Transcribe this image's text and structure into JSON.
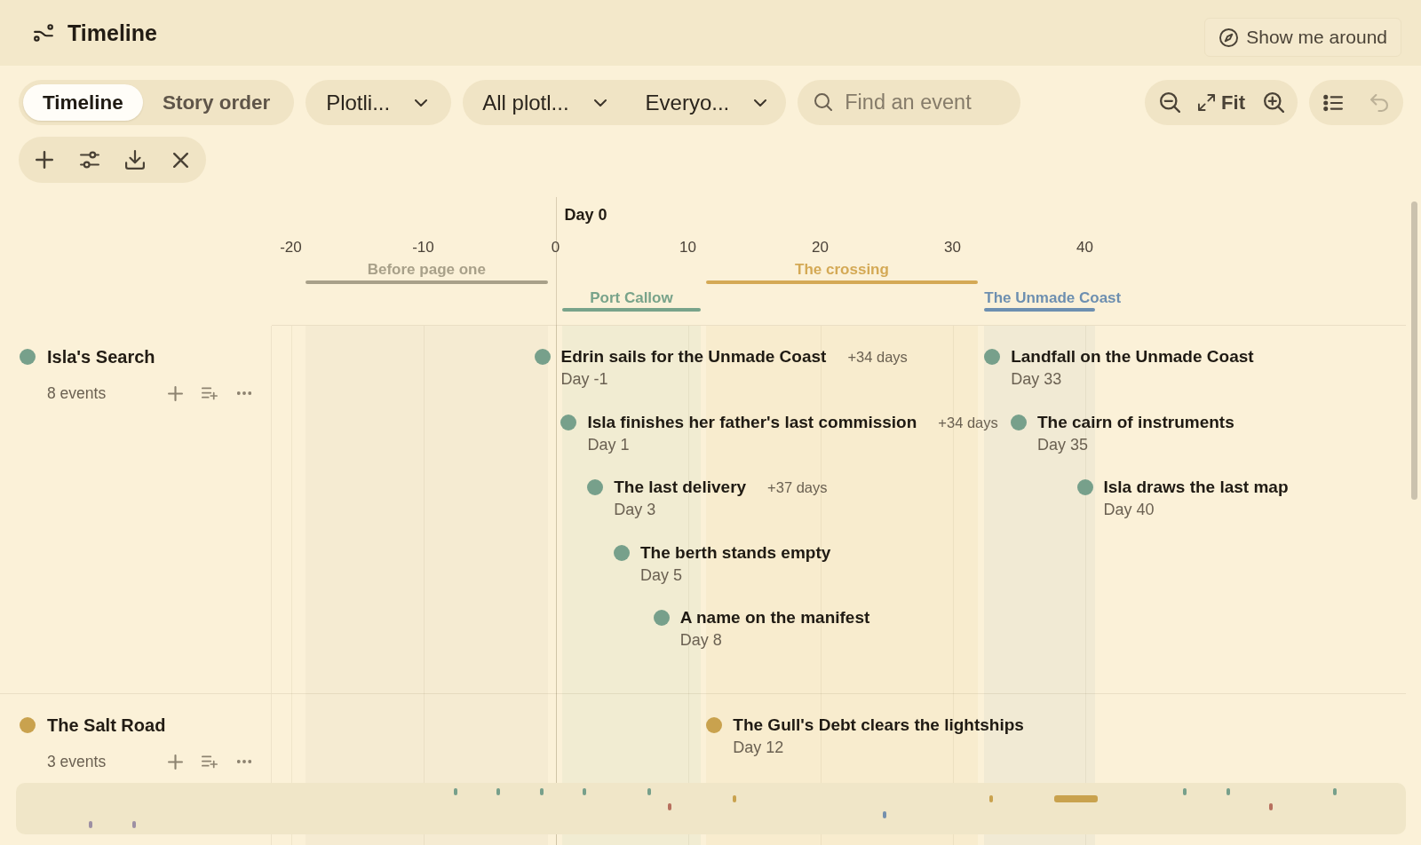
{
  "header": {
    "title": "Timeline",
    "tour_button": "Show me around"
  },
  "toolbar": {
    "view_tabs": [
      {
        "label": "Timeline",
        "selected": true
      },
      {
        "label": "Story order",
        "selected": false
      }
    ],
    "group_by": "Plotli...",
    "filters": [
      "All plotl...",
      "Everyo..."
    ],
    "search": {
      "placeholder": "Find an event"
    },
    "fit_label": "Fit",
    "undo": {
      "disabled": true
    }
  },
  "axis": {
    "origin_label": "Day 0",
    "ticks": [
      "-20",
      "-10",
      "0",
      "10",
      "20",
      "30",
      "40"
    ]
  },
  "eras": [
    {
      "label": "Before page one",
      "color": "#a8a089"
    },
    {
      "label": "Port Callow",
      "color": "#78a38a"
    },
    {
      "label": "The crossing",
      "color": "#d4a955"
    },
    {
      "label": "The Unmade Coast",
      "color": "#6d8fb0"
    }
  ],
  "lanes": [
    {
      "name": "Isla's Search",
      "color": "#77a08b",
      "count": "8 events",
      "events": [
        {
          "title": "Edrin sails for the Unmade Coast",
          "day": "Day -1",
          "gap": "+34 days"
        },
        {
          "title": "Isla finishes her father's last commission",
          "day": "Day 1",
          "gap": "+34 days"
        },
        {
          "title": "The last delivery",
          "day": "Day 3",
          "gap": "+37 days"
        },
        {
          "title": "The berth stands empty",
          "day": "Day 5"
        },
        {
          "title": "A name on the manifest",
          "day": "Day 8"
        },
        {
          "title": "Landfall on the Unmade Coast",
          "day": "Day 33"
        },
        {
          "title": "The cairn of instruments",
          "day": "Day 35"
        },
        {
          "title": "Isla draws the last map",
          "day": "Day 40"
        }
      ]
    },
    {
      "name": "The Salt Road",
      "color": "#c9a24e",
      "count": "3 events",
      "events": [
        {
          "title": "The Gull's Debt clears the lightships",
          "day": "Day 12"
        }
      ]
    }
  ],
  "minimap": {
    "markers": [
      {
        "color": "#77a08b"
      },
      {
        "color": "#77a08b"
      },
      {
        "color": "#77a08b"
      },
      {
        "color": "#77a08b"
      },
      {
        "color": "#77a08b"
      },
      {
        "color": "#77a08b"
      },
      {
        "color": "#77a08b"
      },
      {
        "color": "#77a08b"
      },
      {
        "color": "#c9a24e"
      },
      {
        "color": "#c9a24e"
      },
      {
        "color": "#c9a24e"
      },
      {
        "color": "#b7705e"
      },
      {
        "color": "#b7705e"
      },
      {
        "color": "#7590ad"
      },
      {
        "color": "#9d90a3"
      },
      {
        "color": "#9d90a3"
      }
    ]
  }
}
